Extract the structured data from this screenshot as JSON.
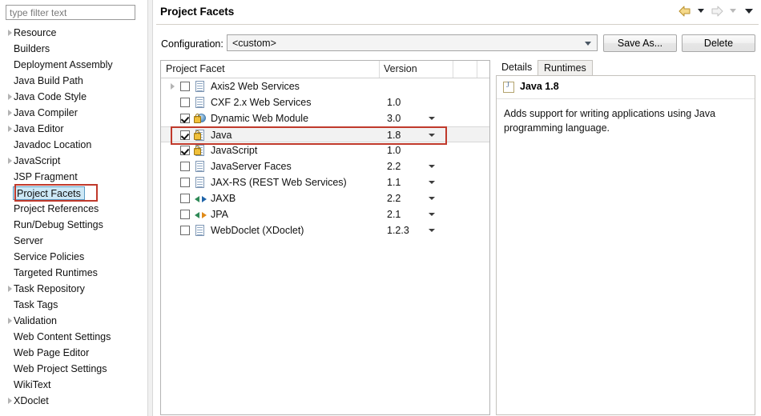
{
  "sidebar": {
    "filter": {
      "value": "",
      "placeholder": "type filter text"
    },
    "items": [
      {
        "label": "Resource",
        "expandable": true,
        "selected": false
      },
      {
        "label": "Builders",
        "expandable": false,
        "selected": false
      },
      {
        "label": "Deployment Assembly",
        "expandable": false,
        "selected": false
      },
      {
        "label": "Java Build Path",
        "expandable": false,
        "selected": false
      },
      {
        "label": "Java Code Style",
        "expandable": true,
        "selected": false
      },
      {
        "label": "Java Compiler",
        "expandable": true,
        "selected": false
      },
      {
        "label": "Java Editor",
        "expandable": true,
        "selected": false
      },
      {
        "label": "Javadoc Location",
        "expandable": false,
        "selected": false
      },
      {
        "label": "JavaScript",
        "expandable": true,
        "selected": false
      },
      {
        "label": "JSP Fragment",
        "expandable": false,
        "selected": false
      },
      {
        "label": "Project Facets",
        "expandable": false,
        "selected": true
      },
      {
        "label": "Project References",
        "expandable": false,
        "selected": false
      },
      {
        "label": "Run/Debug Settings",
        "expandable": false,
        "selected": false
      },
      {
        "label": "Server",
        "expandable": false,
        "selected": false
      },
      {
        "label": "Service Policies",
        "expandable": false,
        "selected": false
      },
      {
        "label": "Targeted Runtimes",
        "expandable": false,
        "selected": false
      },
      {
        "label": "Task Repository",
        "expandable": true,
        "selected": false
      },
      {
        "label": "Task Tags",
        "expandable": false,
        "selected": false
      },
      {
        "label": "Validation",
        "expandable": true,
        "selected": false
      },
      {
        "label": "Web Content Settings",
        "expandable": false,
        "selected": false
      },
      {
        "label": "Web Page Editor",
        "expandable": false,
        "selected": false
      },
      {
        "label": "Web Project Settings",
        "expandable": false,
        "selected": false
      },
      {
        "label": "WikiText",
        "expandable": false,
        "selected": false
      },
      {
        "label": "XDoclet",
        "expandable": true,
        "selected": false
      }
    ]
  },
  "header": {
    "title": "Project Facets",
    "nav": [
      {
        "name": "back-arrow-icon",
        "enabled": true
      },
      {
        "name": "back-dropdown-icon",
        "enabled": true
      },
      {
        "name": "forward-arrow-icon",
        "enabled": false
      },
      {
        "name": "forward-dropdown-icon",
        "enabled": false
      },
      {
        "name": "menu-dropdown-icon",
        "enabled": true
      }
    ]
  },
  "configuration": {
    "label": "Configuration:",
    "value": "<custom>",
    "save_as_label": "Save As...",
    "delete_label": "Delete"
  },
  "facet_table": {
    "columns": [
      "Project Facet",
      "Version"
    ],
    "rows": [
      {
        "name": "Axis2 Web Services",
        "version": "",
        "checked": false,
        "expandable": true,
        "icon": "doc",
        "locked": false,
        "has_version_dropdown": false,
        "selected": false
      },
      {
        "name": "CXF 2.x Web Services",
        "version": "1.0",
        "checked": false,
        "expandable": false,
        "icon": "doc",
        "locked": false,
        "has_version_dropdown": false,
        "selected": false
      },
      {
        "name": "Dynamic Web Module",
        "version": "3.0",
        "checked": true,
        "expandable": false,
        "icon": "globe",
        "locked": true,
        "has_version_dropdown": true,
        "selected": false
      },
      {
        "name": "Java",
        "version": "1.8",
        "checked": true,
        "expandable": false,
        "icon": "doc",
        "locked": true,
        "has_version_dropdown": true,
        "selected": true
      },
      {
        "name": "JavaScript",
        "version": "1.0",
        "checked": true,
        "expandable": false,
        "icon": "doc",
        "locked": true,
        "has_version_dropdown": false,
        "selected": false
      },
      {
        "name": "JavaServer Faces",
        "version": "2.2",
        "checked": false,
        "expandable": false,
        "icon": "doc",
        "locked": false,
        "has_version_dropdown": true,
        "selected": false
      },
      {
        "name": "JAX-RS (REST Web Services)",
        "version": "1.1",
        "checked": false,
        "expandable": false,
        "icon": "doc",
        "locked": false,
        "has_version_dropdown": true,
        "selected": false
      },
      {
        "name": "JAXB",
        "version": "2.2",
        "checked": false,
        "expandable": false,
        "icon": "arrows",
        "locked": false,
        "has_version_dropdown": true,
        "selected": false
      },
      {
        "name": "JPA",
        "version": "2.1",
        "checked": false,
        "expandable": false,
        "icon": "arrows-jpa",
        "locked": false,
        "has_version_dropdown": true,
        "selected": false
      },
      {
        "name": "WebDoclet (XDoclet)",
        "version": "1.2.3",
        "checked": false,
        "expandable": false,
        "icon": "doc",
        "locked": false,
        "has_version_dropdown": true,
        "selected": false
      }
    ]
  },
  "details": {
    "tabs": [
      {
        "label": "Details",
        "active": true
      },
      {
        "label": "Runtimes",
        "active": false
      }
    ],
    "facet_title": "Java 1.8",
    "description": "Adds support for writing applications using Java programming language."
  },
  "annotations": {
    "color": "#c0392b",
    "boxes": [
      "project-facets-sidebar-item",
      "java-facet-row"
    ]
  },
  "colors": {
    "selection_blue": "#cde8f6",
    "selection_border": "#5a9bc4",
    "annotation_red": "#c0392b",
    "row_selected_grey": "#f2f2f2"
  }
}
